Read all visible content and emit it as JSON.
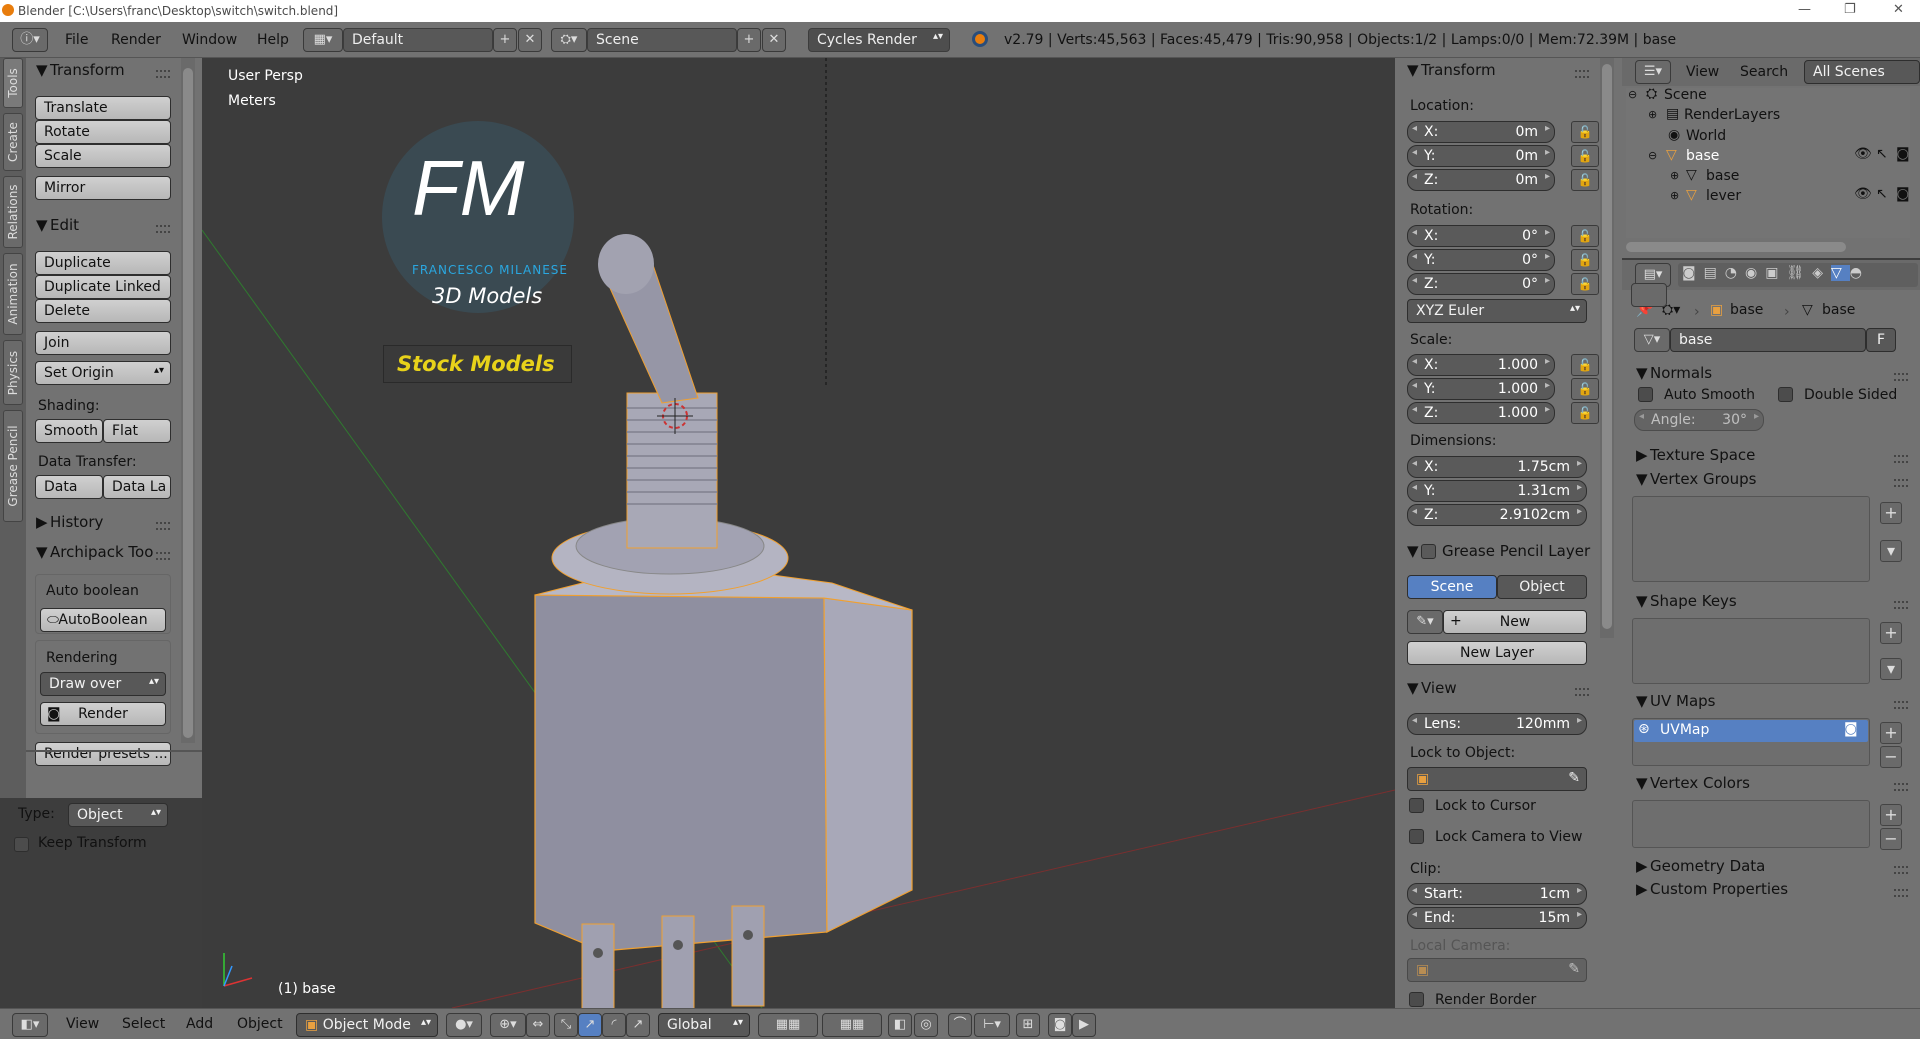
{
  "titlebar": {
    "title": "Blender [C:\\Users\\franc\\Desktop\\switch\\switch.blend]"
  },
  "topbar": {
    "menus": [
      "File",
      "Render",
      "Window",
      "Help"
    ],
    "layout": "Default",
    "scene": "Scene",
    "engine": "Cycles Render",
    "stats": "v2.79 | Verts:45,563 | Faces:45,479 | Tris:90,958 | Objects:1/2 | Lamps:0/0 | Mem:72.39M | base"
  },
  "lefttabs": [
    "Tools",
    "Create",
    "Relations",
    "Animation",
    "Physics",
    "Grease Pencil"
  ],
  "toolshelf": {
    "transform": {
      "header": "Transform",
      "buttons": [
        "Translate",
        "Rotate",
        "Scale",
        "Mirror"
      ]
    },
    "edit": {
      "header": "Edit",
      "buttons": [
        "Duplicate",
        "Duplicate Linked",
        "Delete",
        "Join"
      ],
      "set_origin": "Set Origin",
      "shading_label": "Shading:",
      "smooth": "Smooth",
      "flat": "Flat",
      "data_transfer_label": "Data Transfer:",
      "data": "Data",
      "data_la": "Data La"
    },
    "history": "History",
    "archipack": {
      "header": "Archipack Too",
      "auto_boolean_label": "Auto boolean",
      "auto_boolean_button": "AutoBoolean",
      "rendering_label": "Rendering",
      "draw_over": "Draw over",
      "render": "Render",
      "render_presets": "Render presets ..."
    },
    "type_label": "Type:",
    "type_value": "Object",
    "keep_transform": "Keep Transform"
  },
  "viewport": {
    "view_name": "User Persp",
    "units": "Meters",
    "object_label": "(1) base",
    "logo": {
      "fm": "FM",
      "name": "FRANCESCO MILANESE",
      "models": "3D Models",
      "stock": "Stock Models"
    }
  },
  "props": {
    "transform": "Transform",
    "location_label": "Location:",
    "location": [
      {
        "k": "X:",
        "v": "0m"
      },
      {
        "k": "Y:",
        "v": "0m"
      },
      {
        "k": "Z:",
        "v": "0m"
      }
    ],
    "rotation_label": "Rotation:",
    "rotation": [
      {
        "k": "X:",
        "v": "0°"
      },
      {
        "k": "Y:",
        "v": "0°"
      },
      {
        "k": "Z:",
        "v": "0°"
      }
    ],
    "rotation_mode": "XYZ Euler",
    "scale_label": "Scale:",
    "scale": [
      {
        "k": "X:",
        "v": "1.000"
      },
      {
        "k": "Y:",
        "v": "1.000"
      },
      {
        "k": "Z:",
        "v": "1.000"
      }
    ],
    "dimensions_label": "Dimensions:",
    "dimensions": [
      {
        "k": "X:",
        "v": "1.75cm"
      },
      {
        "k": "Y:",
        "v": "1.31cm"
      },
      {
        "k": "Z:",
        "v": "2.9102cm"
      }
    ],
    "grease_pencil": "Grease Pencil Layer",
    "gp_scene": "Scene",
    "gp_object": "Object",
    "gp_new": "New",
    "gp_new_layer": "New Layer",
    "view": "View",
    "lens_k": "Lens:",
    "lens_v": "120mm",
    "lock_to_object": "Lock to Object:",
    "lock_to_cursor": "Lock to Cursor",
    "lock_camera": "Lock Camera to View",
    "clip_label": "Clip:",
    "clip_start_k": "Start:",
    "clip_start_v": "1cm",
    "clip_end_k": "End:",
    "clip_end_v": "15m",
    "local_camera": "Local Camera:",
    "render_border": "Render Border"
  },
  "outliner": {
    "view": "View",
    "search": "Search",
    "all_scenes": "All Scenes",
    "items": [
      "Scene",
      "RenderLayers",
      "World",
      "base",
      "base",
      "lever"
    ]
  },
  "rightprops": {
    "breadcrumb_obj": "base",
    "breadcrumb_data": "base",
    "mesh_name": "base",
    "fake_user": "F",
    "normals": "Normals",
    "auto_smooth": "Auto Smooth",
    "double_sided": "Double Sided",
    "angle_k": "Angle:",
    "angle_v": "30°",
    "texture_space": "Texture Space",
    "vertex_groups": "Vertex Groups",
    "shape_keys": "Shape Keys",
    "uv_maps": "UV Maps",
    "uvmap": "UVMap",
    "vertex_colors": "Vertex Colors",
    "geometry_data": "Geometry Data",
    "custom_properties": "Custom Properties"
  },
  "bottombar": {
    "menus": [
      "View",
      "Select",
      "Add",
      "Object"
    ],
    "mode": "Object Mode",
    "orientation": "Global"
  },
  "colors": {
    "accent_blue": "#5680c2",
    "selection_orange": "#f0a030",
    "logo_blue": "#2aa7e0",
    "logo_yellow": "#e8d21a"
  }
}
